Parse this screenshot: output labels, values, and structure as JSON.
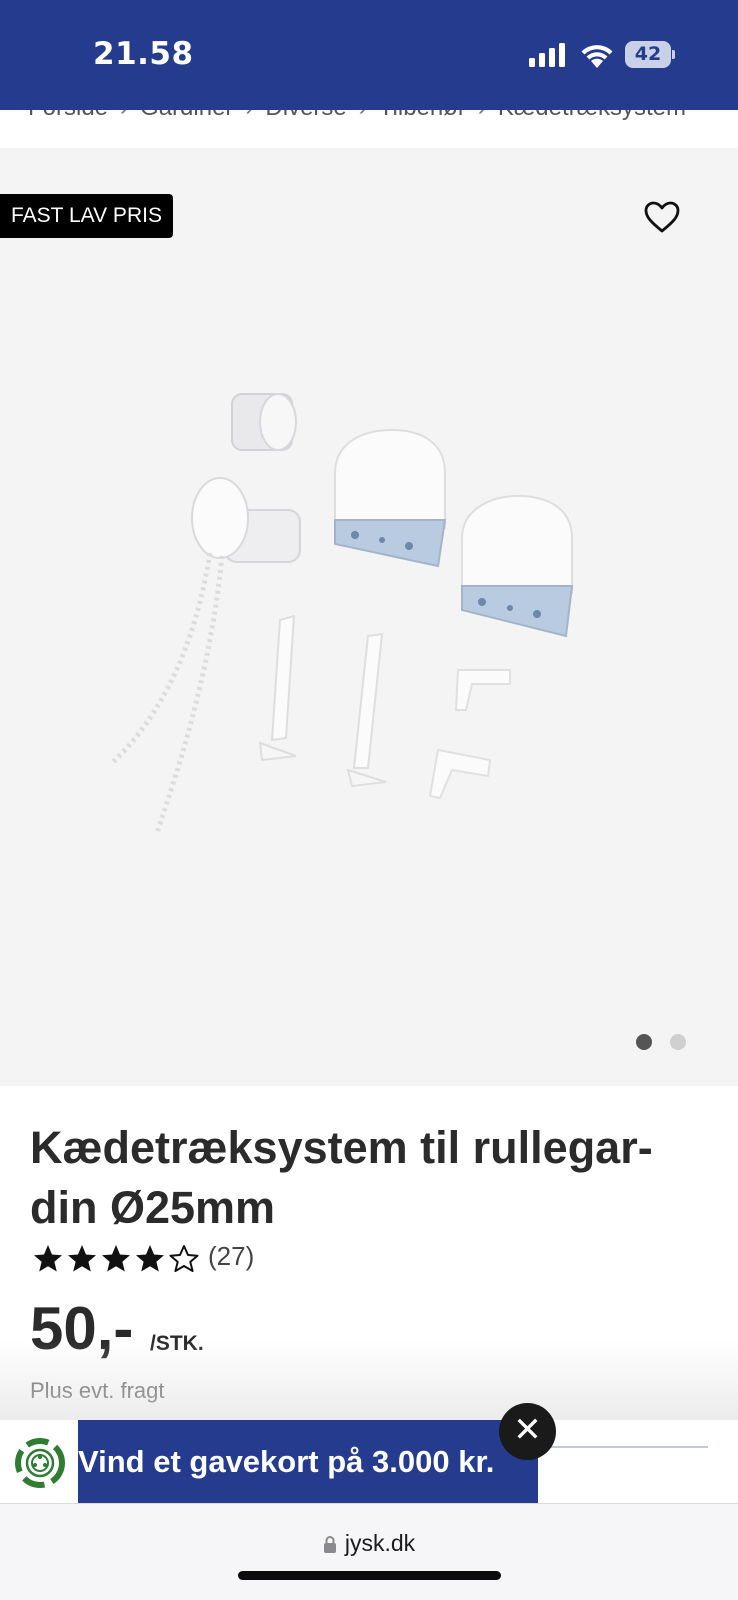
{
  "status_bar": {
    "time": "21.58",
    "battery": "42",
    "background": "#253b8e"
  },
  "breadcrumb": {
    "items": [
      "Forside",
      "Gardiner",
      "Diverse",
      "Tilbehør",
      "Kædetræksystem"
    ],
    "separator": "›"
  },
  "gallery": {
    "badge": "FAST LAV PRIS",
    "favorite_icon": "heart-outline-icon",
    "image_count": 2,
    "active_image": 1
  },
  "product": {
    "title": "Kædetræksystem til rullegar-din Ø25mm",
    "title_line1": "Kædetræksystem til rullegar-",
    "title_line2": "din Ø25mm",
    "rating": 4,
    "rating_max": 5,
    "review_count": "(27)",
    "price": "50,-",
    "price_unit": "/STK.",
    "shipping_note": "Plus evt. fragt"
  },
  "promo": {
    "text": "Vind et gavekort på 3.000 kr.",
    "close_label": "✕",
    "icon": "recycle-badge-icon",
    "color": "#253b8e"
  },
  "browser": {
    "url": "jysk.dk"
  }
}
